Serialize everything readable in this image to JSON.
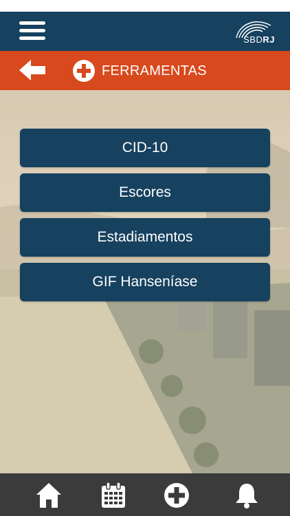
{
  "header": {
    "logo_text_bold": "SBD",
    "logo_text_suffix": "RJ",
    "menu_icon": "hamburger-menu-icon"
  },
  "titlebar": {
    "back_icon": "back-arrow-icon",
    "section_icon": "plus-circle-icon",
    "title": "FERRAMENTAS"
  },
  "menu": {
    "items": [
      {
        "label": "CID-10"
      },
      {
        "label": "Escores"
      },
      {
        "label": "Estadiamentos"
      },
      {
        "label": "GIF Hanseníase"
      }
    ]
  },
  "bottom_nav": {
    "items": [
      {
        "icon": "home-icon"
      },
      {
        "icon": "calendar-icon"
      },
      {
        "icon": "plus-circle-icon"
      },
      {
        "icon": "bell-icon"
      }
    ]
  },
  "colors": {
    "primary": "#16415f",
    "accent": "#d8491d",
    "bottombar": "#3b3b3b"
  }
}
